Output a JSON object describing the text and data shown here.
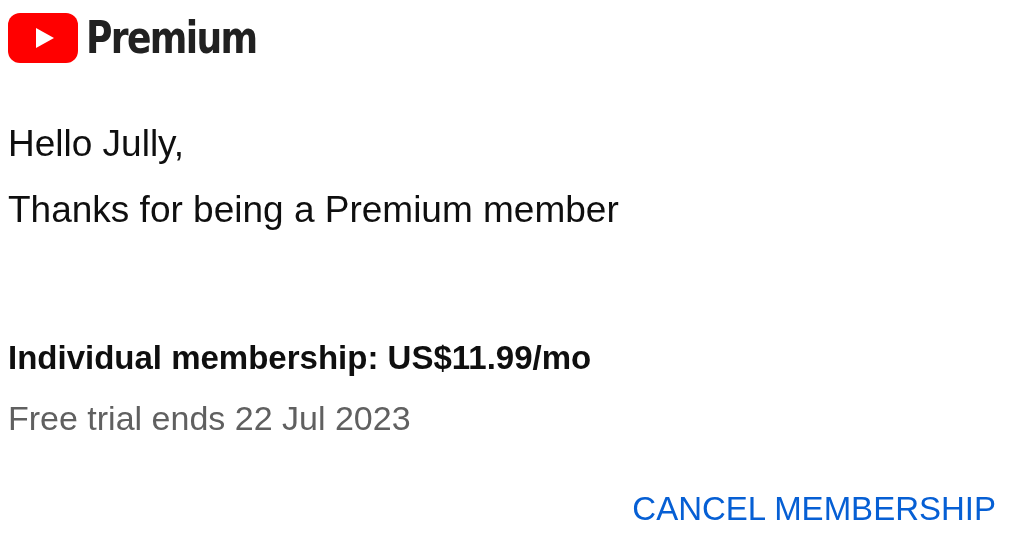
{
  "logo": {
    "text": "Premium"
  },
  "greeting": "Hello Jully,",
  "thanks": "Thanks for being a Premium member",
  "membership": {
    "plan": "Individual membership: US$11.99/mo",
    "trial": "Free trial ends 22 Jul 2023"
  },
  "action": {
    "label": "CANCEL MEMBERSHIP"
  }
}
